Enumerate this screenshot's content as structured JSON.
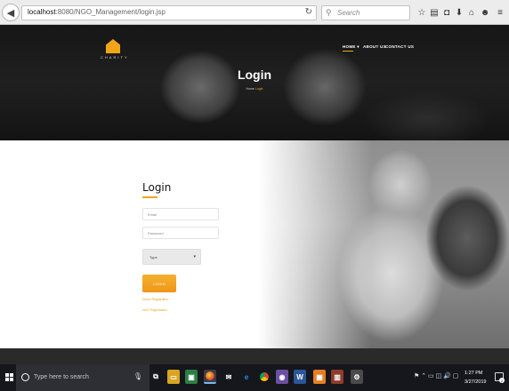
{
  "browser": {
    "url_host": "localhost",
    "url_path": ":8080/NGO_Management/login.jsp",
    "search_placeholder": "Search",
    "icons": [
      "back-icon",
      "reload-icon",
      "search-icon",
      "star-icon",
      "reading-list-icon",
      "pocket-icon",
      "download-icon",
      "home-icon",
      "smiley-icon",
      "menu-icon"
    ]
  },
  "hero": {
    "logo_text": "CHARITY",
    "nav": [
      "HOME ▾",
      "ABOUT US",
      "CONTACT US"
    ],
    "title": "Login",
    "breadcrumb_home": "Home",
    "breadcrumb_current": "Login"
  },
  "form": {
    "title": "Login",
    "email_placeholder": "Email",
    "password_placeholder": "Password",
    "type_value": "Type",
    "submit_label": "LOGIN",
    "donor_registration": "Donor Registration",
    "ngo_registration": "NGO Registration"
  },
  "taskbar": {
    "search_placeholder": "Type here to search",
    "time": "1:27 PM",
    "date": "3/27/2019",
    "notification_count": "2",
    "apps": [
      "task-view-icon",
      "file-explorer-icon",
      "store-icon",
      "firefox-icon",
      "mail-icon",
      "edge-icon",
      "chrome-icon",
      "media-icon",
      "word-icon",
      "app-icon",
      "dictionary-icon",
      "tool-icon"
    ],
    "accent": "#76b9ed"
  },
  "colors": {
    "accent": "#f2a51a",
    "footer": "#2a2a2a",
    "taskbar": "#15171c"
  }
}
